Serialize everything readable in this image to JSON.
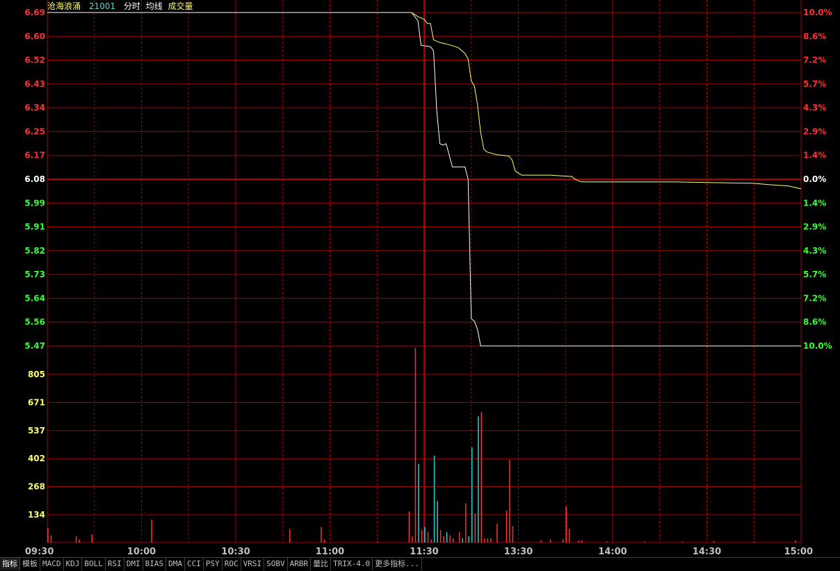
{
  "header": {
    "stock_name": "沧海浪涌",
    "stock_code": "21001",
    "view_label": "分时",
    "avg_label": "均线",
    "volume_label": "成交量"
  },
  "colors": {
    "grid": "#b00000",
    "price_line": "#ffffff",
    "avg_line": "#ffff66",
    "up": "#ff3030",
    "down": "#33ff33",
    "flat": "#ffffff",
    "volume_axis": "#ffff66",
    "vol_up": "#ff3030",
    "vol_down": "#33cccc",
    "time_label": "#c0c0c0"
  },
  "chart_data": {
    "type": "line",
    "prev_close": 6.08,
    "price_axis": {
      "ticks": [
        "6.69",
        "6.60",
        "6.52",
        "6.43",
        "6.34",
        "6.25",
        "6.17",
        "6.08",
        "5.99",
        "5.91",
        "5.82",
        "5.73",
        "5.64",
        "5.56",
        "5.47"
      ],
      "pct_ticks": [
        "10.0%",
        "8.6%",
        "7.2%",
        "5.7%",
        "4.3%",
        "2.9%",
        "1.4%",
        "0.0%",
        "1.4%",
        "2.9%",
        "4.3%",
        "5.7%",
        "7.2%",
        "8.6%",
        "10.0%"
      ],
      "ylim": [
        5.47,
        6.69
      ]
    },
    "volume_axis": {
      "ticks": [
        "805",
        "671",
        "537",
        "402",
        "268",
        "134"
      ],
      "ylim": [
        0,
        940
      ]
    },
    "x_ticks": [
      "09:30",
      "10:00",
      "10:30",
      "11:00",
      "11:30",
      "13:30",
      "14:00",
      "14:30",
      "15:00"
    ],
    "series": [
      {
        "points": [
          [
            0,
            6.69
          ],
          [
            116,
            6.69
          ],
          [
            118,
            6.66
          ],
          [
            119,
            6.57
          ],
          [
            122,
            6.565
          ],
          [
            123,
            6.55
          ],
          [
            124,
            6.33
          ],
          [
            125,
            6.21
          ],
          [
            126,
            6.205
          ],
          [
            127,
            6.21
          ],
          [
            129,
            6.125
          ],
          [
            133,
            6.125
          ],
          [
            134,
            6.08
          ],
          [
            135,
            5.57
          ],
          [
            136,
            5.56
          ],
          [
            137,
            5.53
          ],
          [
            138,
            5.47
          ],
          [
            240,
            5.47
          ]
        ]
      },
      {
        "points": [
          [
            0,
            6.69
          ],
          [
            116,
            6.69
          ],
          [
            118,
            6.675
          ],
          [
            120,
            6.665
          ],
          [
            121,
            6.65
          ],
          [
            122,
            6.65
          ],
          [
            123,
            6.59
          ],
          [
            125,
            6.58
          ],
          [
            127,
            6.575
          ],
          [
            130,
            6.565
          ],
          [
            131,
            6.56
          ],
          [
            133,
            6.54
          ],
          [
            134,
            6.52
          ],
          [
            135,
            6.44
          ],
          [
            136,
            6.42
          ],
          [
            137,
            6.35
          ],
          [
            138,
            6.25
          ],
          [
            139,
            6.19
          ],
          [
            140,
            6.18
          ],
          [
            143,
            6.17
          ],
          [
            147,
            6.165
          ],
          [
            148,
            6.15
          ],
          [
            149,
            6.11
          ],
          [
            151,
            6.095
          ],
          [
            160,
            6.095
          ],
          [
            167,
            6.09
          ],
          [
            168,
            6.08
          ],
          [
            170,
            6.07
          ],
          [
            180,
            6.07
          ],
          [
            200,
            6.07
          ],
          [
            215,
            6.067
          ],
          [
            225,
            6.065
          ],
          [
            230,
            6.06
          ],
          [
            236,
            6.055
          ],
          [
            240,
            6.045
          ]
        ]
      }
    ],
    "volume": [
      {
        "t": 0,
        "v": 70,
        "d": "up"
      },
      {
        "t": 1,
        "v": 35,
        "d": "up"
      },
      {
        "t": 9,
        "v": 30,
        "d": "up"
      },
      {
        "t": 10,
        "v": 15,
        "d": "up"
      },
      {
        "t": 14,
        "v": 40,
        "d": "up"
      },
      {
        "t": 33,
        "v": 110,
        "d": "up"
      },
      {
        "t": 77,
        "v": 65,
        "d": "up"
      },
      {
        "t": 87,
        "v": 75,
        "d": "up"
      },
      {
        "t": 88,
        "v": 15,
        "d": "up"
      },
      {
        "t": 105,
        "v": 5,
        "d": "up"
      },
      {
        "t": 115,
        "v": 150,
        "d": "up"
      },
      {
        "t": 116,
        "v": 30,
        "d": "up"
      },
      {
        "t": 117,
        "v": 940,
        "d": "up"
      },
      {
        "t": 118,
        "v": 380,
        "d": "down"
      },
      {
        "t": 119,
        "v": 60,
        "d": "up"
      },
      {
        "t": 120,
        "v": 75,
        "d": "down"
      },
      {
        "t": 121,
        "v": 50,
        "d": "up"
      },
      {
        "t": 122,
        "v": 15,
        "d": "up"
      },
      {
        "t": 123,
        "v": 420,
        "d": "down"
      },
      {
        "t": 124,
        "v": 200,
        "d": "down"
      },
      {
        "t": 125,
        "v": 60,
        "d": "up"
      },
      {
        "t": 126,
        "v": 30,
        "d": "up"
      },
      {
        "t": 127,
        "v": 50,
        "d": "down"
      },
      {
        "t": 128,
        "v": 35,
        "d": "up"
      },
      {
        "t": 129,
        "v": 20,
        "d": "up"
      },
      {
        "t": 131,
        "v": 50,
        "d": "up"
      },
      {
        "t": 132,
        "v": 20,
        "d": "down"
      },
      {
        "t": 133,
        "v": 190,
        "d": "up"
      },
      {
        "t": 134,
        "v": 30,
        "d": "down"
      },
      {
        "t": 135,
        "v": 460,
        "d": "down"
      },
      {
        "t": 136,
        "v": 140,
        "d": "up"
      },
      {
        "t": 137,
        "v": 610,
        "d": "down"
      },
      {
        "t": 138,
        "v": 630,
        "d": "up"
      },
      {
        "t": 139,
        "v": 20,
        "d": "up"
      },
      {
        "t": 140,
        "v": 20,
        "d": "up"
      },
      {
        "t": 141,
        "v": 20,
        "d": "up"
      },
      {
        "t": 143,
        "v": 90,
        "d": "up"
      },
      {
        "t": 146,
        "v": 155,
        "d": "up"
      },
      {
        "t": 147,
        "v": 400,
        "d": "up"
      },
      {
        "t": 148,
        "v": 80,
        "d": "up"
      },
      {
        "t": 157,
        "v": 10,
        "d": "up"
      },
      {
        "t": 160,
        "v": 15,
        "d": "up"
      },
      {
        "t": 164,
        "v": 15,
        "d": "up"
      },
      {
        "t": 165,
        "v": 175,
        "d": "up"
      },
      {
        "t": 166,
        "v": 65,
        "d": "up"
      },
      {
        "t": 169,
        "v": 10,
        "d": "up"
      },
      {
        "t": 170,
        "v": 10,
        "d": "up"
      },
      {
        "t": 178,
        "v": 5,
        "d": "up"
      },
      {
        "t": 190,
        "v": 5,
        "d": "up"
      },
      {
        "t": 202,
        "v": 5,
        "d": "up"
      },
      {
        "t": 212,
        "v": 8,
        "d": "up"
      },
      {
        "t": 225,
        "v": 5,
        "d": "up"
      },
      {
        "t": 238,
        "v": 10,
        "d": "up"
      }
    ]
  },
  "indicator_tabs": [
    "指标",
    "模板",
    "MACD",
    "KDJ",
    "BOLL",
    "RSI",
    "DMI",
    "BIAS",
    "DMA",
    "CCI",
    "PSY",
    "ROC",
    "VRSI",
    "SOBV",
    "ARBR",
    "量比",
    "TRIX-4.0",
    "更多指标..."
  ]
}
